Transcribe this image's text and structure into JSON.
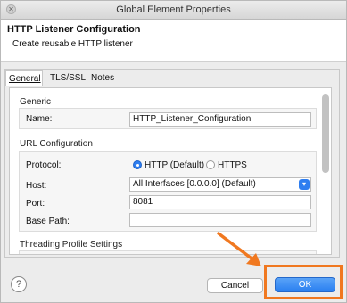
{
  "window": {
    "title": "Global Element Properties"
  },
  "header": {
    "title": "HTTP Listener Configuration",
    "subtitle": "Create reusable HTTP listener"
  },
  "tabs": [
    {
      "label": "General",
      "selected": true
    },
    {
      "label": "TLS/SSL",
      "selected": false
    },
    {
      "label": "Notes",
      "selected": false
    }
  ],
  "general": {
    "section_generic": "Generic",
    "name_label": "Name:",
    "name_value": "HTTP_Listener_Configuration",
    "section_url": "URL Configuration",
    "protocol_label": "Protocol:",
    "protocol_options": [
      {
        "label": "HTTP (Default)",
        "selected": true
      },
      {
        "label": "HTTPS",
        "selected": false
      }
    ],
    "host_label": "Host:",
    "host_value": "All Interfaces [0.0.0.0] (Default)",
    "port_label": "Port:",
    "port_value": "8081",
    "base_path_label": "Base Path:",
    "base_path_value": "",
    "section_threading": "Threading Profile Settings"
  },
  "buttons": {
    "help": "?",
    "cancel": "Cancel",
    "ok": "OK"
  },
  "colors": {
    "accent": "#2e7ef0",
    "highlight": "#f07820"
  },
  "icons": {
    "close": "close-icon",
    "help": "help-icon",
    "dropdown": "chevron-down-icon",
    "annotation": "arrow-icon"
  }
}
